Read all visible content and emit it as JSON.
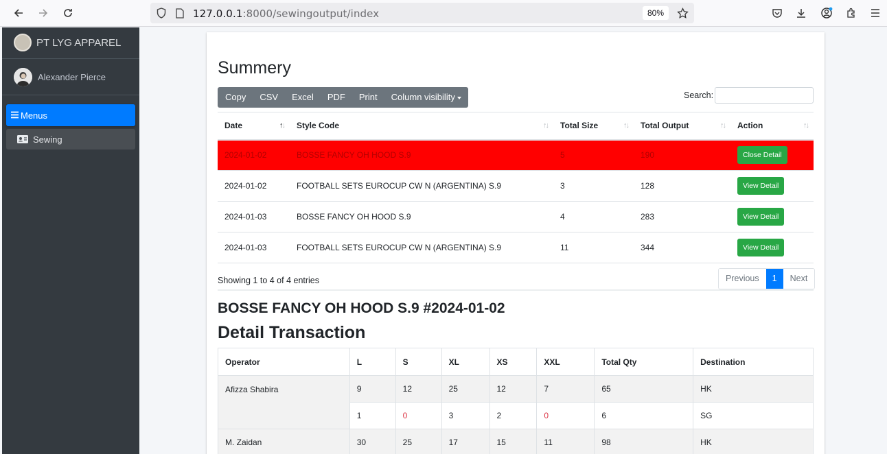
{
  "browser": {
    "url_host": "127.0.0.1",
    "url_rest": ":8000/sewingoutput/index",
    "zoom": "80%"
  },
  "sidebar": {
    "brand": "PT LYG APPAREL",
    "user": "Alexander Pierce",
    "menu_label": "Menus",
    "items": [
      {
        "label": "Sewing",
        "icon": "id-card-icon"
      }
    ]
  },
  "summary": {
    "title": "Summery",
    "buttons": [
      "Copy",
      "CSV",
      "Excel",
      "PDF",
      "Print",
      "Column visibility"
    ],
    "search_label": "Search:",
    "columns": [
      "Date",
      "Style Code",
      "Total Size",
      "Total Output",
      "Action"
    ],
    "rows": [
      {
        "date": "2024-01-02",
        "style": "BOSSE FANCY OH HOOD S.9",
        "size": "5",
        "output": "190",
        "action": "Close Detail",
        "highlight": true
      },
      {
        "date": "2024-01-02",
        "style": "FOOTBALL SETS EUROCUP CW N (ARGENTINA) S.9",
        "size": "3",
        "output": "128",
        "action": "View Detail"
      },
      {
        "date": "2024-01-03",
        "style": "BOSSE FANCY OH HOOD S.9",
        "size": "4",
        "output": "283",
        "action": "View Detail"
      },
      {
        "date": "2024-01-03",
        "style": "FOOTBALL SETS EUROCUP CW N (ARGENTINA) S.9",
        "size": "11",
        "output": "344",
        "action": "View Detail"
      }
    ],
    "info": "Showing 1 to 4 of 4 entries",
    "pager": {
      "previous": "Previous",
      "page": "1",
      "next": "Next"
    }
  },
  "detail": {
    "heading": "BOSSE FANCY OH HOOD S.9 #2024-01-02",
    "title": "Detail Transaction",
    "columns": [
      "Operator",
      "L",
      "S",
      "XL",
      "XS",
      "XXL",
      "Total Qty",
      "Destination"
    ],
    "rows": [
      {
        "operator": "Afizza Shabira",
        "l": "9",
        "s": "12",
        "xl": "25",
        "xs": "12",
        "xxl": "7",
        "total": "65",
        "dest": "HK"
      },
      {
        "operator": "",
        "l": "1",
        "s": "0",
        "xl": "3",
        "xs": "2",
        "xxl": "0",
        "total": "6",
        "dest": "SG"
      },
      {
        "operator": "M. Zaidan",
        "l": "30",
        "s": "25",
        "xl": "17",
        "xs": "15",
        "xxl": "11",
        "total": "98",
        "dest": "HK"
      }
    ]
  },
  "colors": {
    "accent": "#007bff",
    "highlight_row": "#ff0000",
    "action_button": "#28a745",
    "sidebar": "#343a40"
  }
}
